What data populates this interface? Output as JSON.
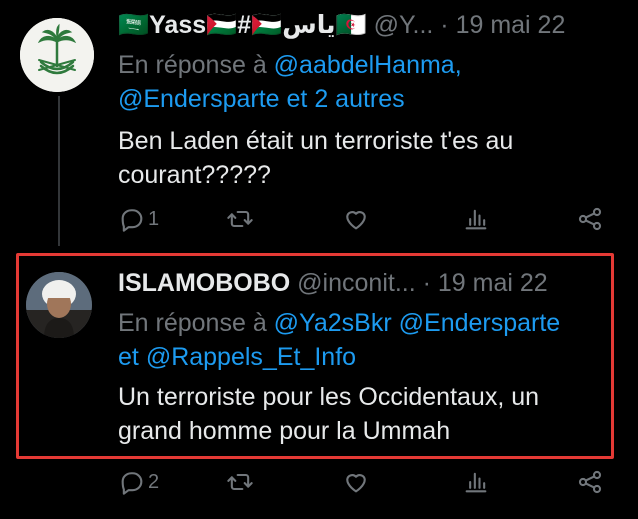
{
  "tweets": [
    {
      "display_name": "🇸🇦Yass🇵🇸#🇵🇸ياس🇩🇿",
      "handle": "@Y...",
      "separator": "·",
      "date": "19 mai 22",
      "reply_prefix": "En réponse à",
      "reply_mentions_line1": "@aabdelHanma,",
      "reply_mentions_line2": "@Endersparte et 2 autres",
      "text_line1": "Ben Laden était un terroriste t'es au",
      "text_line2": "courant?????",
      "reply_count": "1",
      "retweet_count": "",
      "like_count": ""
    },
    {
      "display_name": "ISLAMOBOBO",
      "handle": "@inconit...",
      "separator": "·",
      "date": "19 mai 22",
      "reply_prefix": "En réponse à",
      "reply_mention1": "@Ya2sBkr",
      "reply_mention2": "@Endersparte",
      "reply_conjunction": "et",
      "reply_mention3": "@Rappels_Et_Info",
      "text_line1": "Un terroriste pour les Occidentaux, un",
      "text_line2": "grand homme pour la Ummah",
      "reply_count": "2",
      "retweet_count": "",
      "like_count": ""
    }
  ],
  "icons": [
    "reply-icon",
    "retweet-icon",
    "like-icon",
    "views-icon",
    "share-icon"
  ],
  "colors": {
    "background": "#000000",
    "text": "#e7e9ea",
    "muted": "#71767b",
    "link": "#1d9bf0",
    "highlight_border": "#e53a35"
  }
}
